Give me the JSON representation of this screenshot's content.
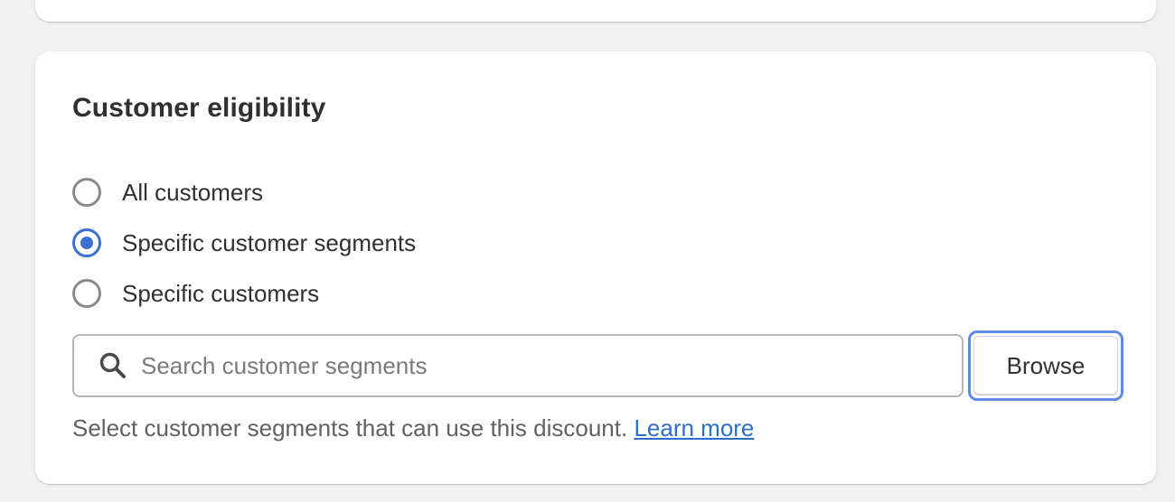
{
  "card": {
    "title": "Customer eligibility",
    "options": [
      {
        "label": "All customers",
        "checked": false
      },
      {
        "label": "Specific customer segments",
        "checked": true
      },
      {
        "label": "Specific customers",
        "checked": false
      }
    ],
    "search": {
      "placeholder": "Search customer segments",
      "value": ""
    },
    "browse_label": "Browse",
    "help_text": "Select customer segments that can use this discount.",
    "help_link": "Learn more"
  },
  "colors": {
    "accent": "#3b6fd0",
    "link": "#2c6ecb",
    "focus_ring": "#5c8ae6"
  }
}
